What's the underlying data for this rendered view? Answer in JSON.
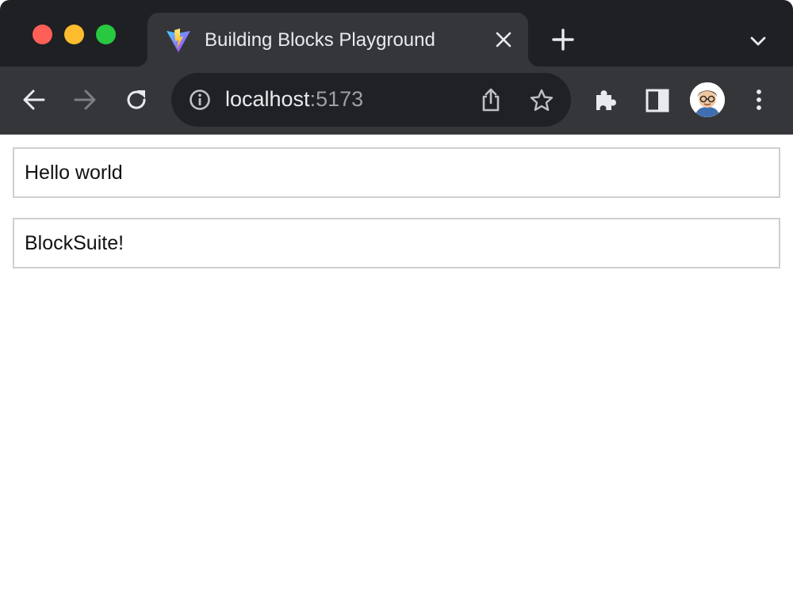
{
  "browser": {
    "tab": {
      "title": "Building Blocks Playground",
      "favicon": "vite-logo-icon"
    },
    "address_bar": {
      "host": "localhost",
      "port": ":5173"
    },
    "icons": {
      "back": "arrow-left-icon",
      "forward": "arrow-right-icon",
      "reload": "reload-icon",
      "info": "info-icon",
      "share": "share-icon",
      "bookmark": "star-icon",
      "extensions": "puzzle-icon",
      "side_panel": "side-panel-icon",
      "menu": "kebab-menu-icon"
    },
    "colors": {
      "frame": "#1f2023",
      "toolbar": "#35363a",
      "omnibox": "#202124",
      "close": "#fe5f57",
      "minimize": "#febc2e",
      "maximize": "#28c840"
    }
  },
  "page": {
    "editors": [
      {
        "text": "Hello world"
      },
      {
        "text": "BlockSuite!"
      }
    ]
  }
}
